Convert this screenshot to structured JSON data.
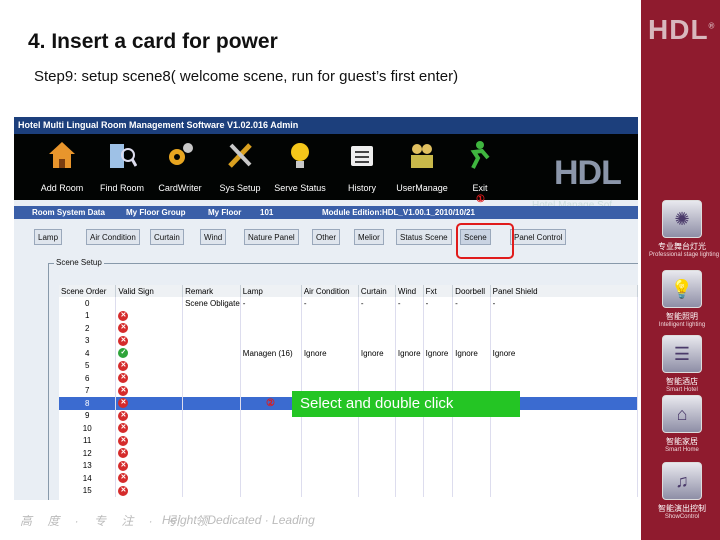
{
  "slide": {
    "title": "4. Insert a card for power",
    "step": "Step9: setup scene8( welcome scene, run for guest’s first enter)",
    "footer_cn": "高 度 · 专 注 · 引 领",
    "footer_en": "Height · Dedicated · Leading"
  },
  "sidebar": {
    "logo": "HDL",
    "items": [
      {
        "cn": "专业舞台灯光",
        "en": "Professional stage lighting",
        "icon": "stage-lighting-icon"
      },
      {
        "cn": "智能照明",
        "en": "Intelligent lighting",
        "icon": "bulb-icon"
      },
      {
        "cn": "智能酒店",
        "en": "Smart Hotel",
        "icon": "hotel-icon"
      },
      {
        "cn": "智能家居",
        "en": "Smart Home",
        "icon": "home-icon"
      },
      {
        "cn": "智能演出控制",
        "en": "ShowControl",
        "icon": "show-control-icon"
      }
    ]
  },
  "app": {
    "title": "Hotel Multi Lingual Room Management Software V1.02.016    Admin",
    "toolbar": [
      {
        "label": "Add Room",
        "icon": "house-icon"
      },
      {
        "label": "Find Room",
        "icon": "building-search-icon"
      },
      {
        "label": "CardWriter",
        "icon": "gears-icon"
      },
      {
        "label": "Sys Setup",
        "icon": "tools-icon"
      },
      {
        "label": "Serve Status",
        "icon": "bulb-icon"
      },
      {
        "label": "History",
        "icon": "list-icon"
      },
      {
        "label": "UserManage",
        "icon": "users-icon"
      },
      {
        "label": "Exit",
        "icon": "exit-icon"
      }
    ],
    "brand": "HDL",
    "brand_sub": "Hotel Manage Sof",
    "infobar": {
      "room_system": "Room System Data",
      "floor_group": "My Floor Group",
      "floor": "My Floor",
      "room": "101",
      "module": "Module Edition:HDL_V1.00.1_2010/10/21"
    },
    "tabs": [
      "Lamp",
      "Air Condition",
      "Curtain",
      "Wind",
      "Nature Panel",
      "Other",
      "Melior",
      "Status Scene",
      "Scene",
      "Panel Control"
    ],
    "active_tab": "Scene",
    "group_title": "Scene Setup",
    "table": {
      "columns": [
        "Scene Order",
        "Valid Sign",
        "Remark",
        "Lamp",
        "Air Condition",
        "Curtain",
        "Wind",
        "Fxt",
        "Doorbell",
        "Panel Shield"
      ],
      "rows": [
        {
          "order": "0",
          "valid": "",
          "remark": "Scene Obligate",
          "lamp": "-",
          "air": "-",
          "curtain": "-",
          "wind": "-",
          "fxt": "-",
          "door": "-",
          "panel": "-"
        },
        {
          "order": "1",
          "valid": "x",
          "remark": "",
          "lamp": "",
          "air": "",
          "curtain": "",
          "wind": "",
          "fxt": "",
          "door": "",
          "panel": ""
        },
        {
          "order": "2",
          "valid": "x",
          "remark": "",
          "lamp": "",
          "air": "",
          "curtain": "",
          "wind": "",
          "fxt": "",
          "door": "",
          "panel": ""
        },
        {
          "order": "3",
          "valid": "x",
          "remark": "",
          "lamp": "",
          "air": "",
          "curtain": "",
          "wind": "",
          "fxt": "",
          "door": "",
          "panel": ""
        },
        {
          "order": "4",
          "valid": "ok",
          "remark": "",
          "lamp": "Managen (16)",
          "air": "Ignore",
          "curtain": "Ignore",
          "wind": "Ignore",
          "fxt": "Ignore",
          "door": "Ignore",
          "panel": "Ignore"
        },
        {
          "order": "5",
          "valid": "x",
          "remark": "",
          "lamp": "",
          "air": "",
          "curtain": "",
          "wind": "",
          "fxt": "",
          "door": "",
          "panel": ""
        },
        {
          "order": "6",
          "valid": "x",
          "remark": "",
          "lamp": "",
          "air": "",
          "curtain": "",
          "wind": "",
          "fxt": "",
          "door": "",
          "panel": ""
        },
        {
          "order": "7",
          "valid": "x",
          "remark": "",
          "lamp": "",
          "air": "",
          "curtain": "",
          "wind": "",
          "fxt": "",
          "door": "",
          "panel": ""
        },
        {
          "order": "8",
          "valid": "x",
          "remark": "",
          "lamp": "",
          "air": "",
          "curtain": "",
          "wind": "",
          "fxt": "",
          "door": "",
          "panel": "",
          "selected": true
        },
        {
          "order": "9",
          "valid": "x",
          "remark": "",
          "lamp": "",
          "air": "",
          "curtain": "",
          "wind": "",
          "fxt": "",
          "door": "",
          "panel": ""
        },
        {
          "order": "10",
          "valid": "x",
          "remark": "",
          "lamp": "",
          "air": "",
          "curtain": "",
          "wind": "",
          "fxt": "",
          "door": "",
          "panel": ""
        },
        {
          "order": "11",
          "valid": "x",
          "remark": "",
          "lamp": "",
          "air": "",
          "curtain": "",
          "wind": "",
          "fxt": "",
          "door": "",
          "panel": ""
        },
        {
          "order": "12",
          "valid": "x",
          "remark": "",
          "lamp": "",
          "air": "",
          "curtain": "",
          "wind": "",
          "fxt": "",
          "door": "",
          "panel": ""
        },
        {
          "order": "13",
          "valid": "x",
          "remark": "",
          "lamp": "",
          "air": "",
          "curtain": "",
          "wind": "",
          "fxt": "",
          "door": "",
          "panel": ""
        },
        {
          "order": "14",
          "valid": "x",
          "remark": "",
          "lamp": "",
          "air": "",
          "curtain": "",
          "wind": "",
          "fxt": "",
          "door": "",
          "panel": ""
        },
        {
          "order": "15",
          "valid": "x",
          "remark": "",
          "lamp": "",
          "air": "",
          "curtain": "",
          "wind": "",
          "fxt": "",
          "door": "",
          "panel": ""
        }
      ]
    }
  },
  "annotations": {
    "mark1": "①",
    "mark2": "②",
    "callout": "Select and double click"
  },
  "colors": {
    "sidebar": "#8f1b2e",
    "highlight": "#e01b1b",
    "callout": "#24c524",
    "selected_row": "#3b6bd0"
  }
}
